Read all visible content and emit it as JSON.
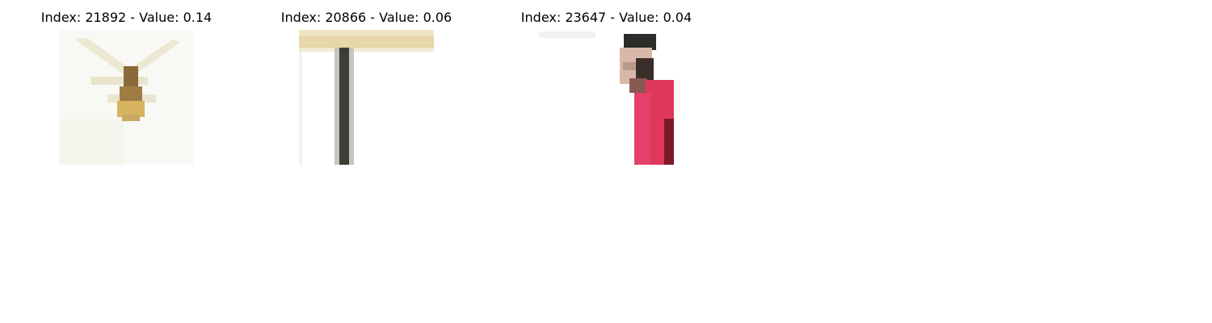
{
  "figure": {
    "panels": [
      {
        "title": "Index: 21892 - Value: 0.14",
        "image": "insect-on-white-background"
      },
      {
        "title": "Index: 20866 - Value: 0.06",
        "image": "table-with-black-leg"
      },
      {
        "title": "Index: 23647 - Value: 0.04",
        "image": "person-in-red-shirt"
      }
    ]
  }
}
